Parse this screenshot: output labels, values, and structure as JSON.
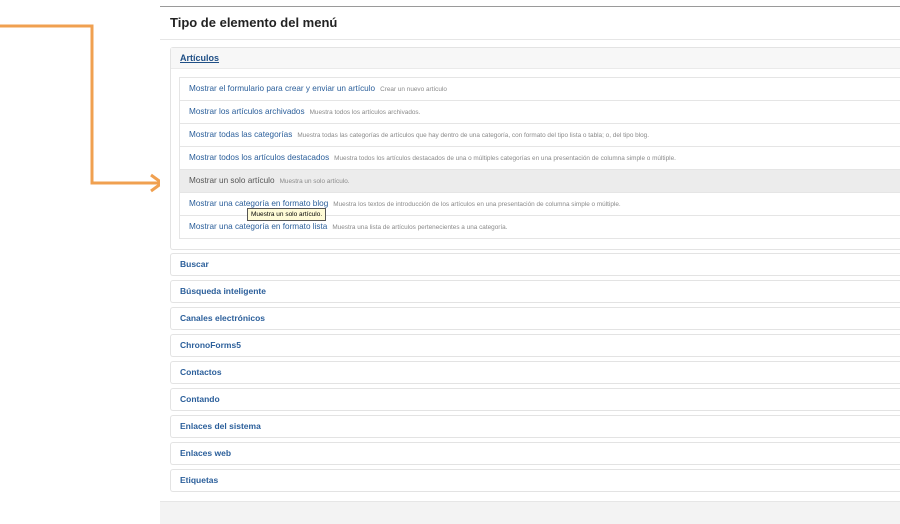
{
  "modal": {
    "title": "Tipo de elemento del menú"
  },
  "open_group": {
    "label": "Artículos",
    "items": [
      {
        "title": "Mostrar el formulario para crear y enviar un artículo",
        "desc": "Crear un nuevo artículo"
      },
      {
        "title": "Mostrar los artículos archivados",
        "desc": "Muestra todos los artículos archivados."
      },
      {
        "title": "Mostrar todas las categorías",
        "desc": "Muestra todas las categorías de artículos que hay dentro de una categoría, con formato del tipo lista o tabla; o, del tipo blog."
      },
      {
        "title": "Mostrar todos los artículos destacados",
        "desc": "Muestra todos los artículos destacados de una o múltiples categorías en una presentación de columna simple o múltiple."
      },
      {
        "title": "Mostrar un solo artículo",
        "desc": "Muestra un solo artículo."
      },
      {
        "title": "Mostrar una categoría en formato blog",
        "desc": "Muestra los textos de introducción de los artículos en una presentación de columna simple o múltiple."
      },
      {
        "title": "Mostrar una categoría en formato lista",
        "desc": "Muestra una lista de artículos pertenecientes a una categoría."
      }
    ],
    "active_index": 4
  },
  "tooltip": {
    "text": "Muestra un solo artículo."
  },
  "groups": [
    {
      "label": "Buscar"
    },
    {
      "label": "Búsqueda inteligente"
    },
    {
      "label": "Canales electrónicos"
    },
    {
      "label": "ChronoForms5"
    },
    {
      "label": "Contactos"
    },
    {
      "label": "Contando"
    },
    {
      "label": "Enlaces del sistema"
    },
    {
      "label": "Enlaces web"
    },
    {
      "label": "Etiquetas"
    }
  ],
  "colors": {
    "annotation_arrow": "#f0a050",
    "link": "#2a5e9a",
    "active_row": "#ececec"
  }
}
